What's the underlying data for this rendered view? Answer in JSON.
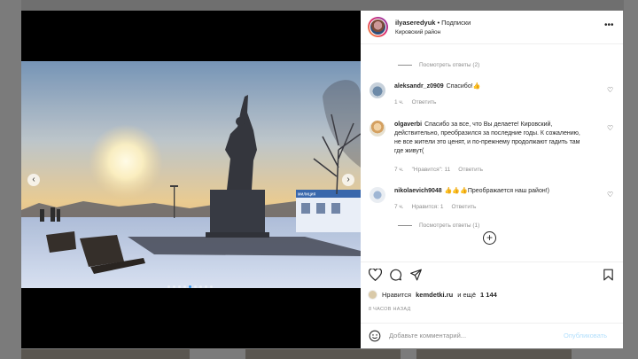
{
  "post": {
    "username": "ilyaseredyuk",
    "separator": "•",
    "follow_status": "Подписки",
    "location": "Кировский район",
    "more_icon": "more-horizontal-icon"
  },
  "media": {
    "slide_count": 9,
    "active_slide": 5,
    "prev_icon": "chevron-left-icon",
    "next_icon": "chevron-right-icon"
  },
  "comments": {
    "replies_top": "Посмотреть ответы (2)",
    "items": [
      {
        "username": "aleksandr_z0909",
        "text": "Спасибо!👍",
        "time": "1 ч.",
        "likes": "",
        "reply": "Ответить"
      },
      {
        "username": "olgaverbi",
        "text": "Спасибо за все, что Вы делаете! Кировский, действительно, преобразился за последние годы. К сожалению, не все жители это ценят, и по-прежнему продолжают гадить там где живут(",
        "time": "7 ч.",
        "likes": "\"Нравится\": 11",
        "reply": "Ответить"
      },
      {
        "username": "nikolaevich9048",
        "text": "👍👍👍Преображается наш район!)",
        "time": "7 ч.",
        "likes": "Нравится: 1",
        "reply": "Ответить"
      }
    ],
    "replies_bottom": "Посмотреть ответы (1)",
    "load_more_icon": "plus-circle-icon"
  },
  "likes": {
    "prefix": "Нравится",
    "user": "kemdetki.ru",
    "suffix": "и ещё",
    "count": "1 144"
  },
  "time_ago": "8 ЧАСОВ НАЗАД",
  "add_comment": {
    "placeholder": "Добавьте комментарий...",
    "publish_label": "Опубликовать"
  },
  "colors": {
    "accent": "#3897f0",
    "publish_disabled": "#b2dffc",
    "meta": "#8e8e8e"
  }
}
